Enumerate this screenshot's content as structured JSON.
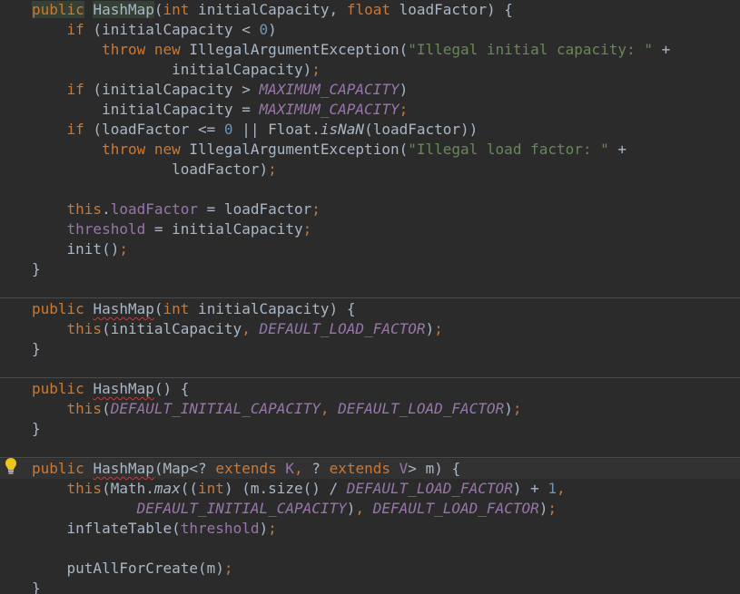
{
  "editor": {
    "lines": [
      {
        "tokens": [
          [
            "kw",
            "public"
          ],
          [
            "txt",
            " "
          ],
          [
            "ctor",
            "HashMap"
          ],
          [
            "txt",
            "("
          ],
          [
            "kw",
            "int"
          ],
          [
            "txt",
            " initialCapacity, "
          ],
          [
            "kw",
            "float"
          ],
          [
            "txt",
            " loadFactor) {"
          ]
        ]
      },
      {
        "tokens": [
          [
            "txt",
            "    "
          ],
          [
            "kw",
            "if"
          ],
          [
            "txt",
            " (initialCapacity < "
          ],
          [
            "num",
            "0"
          ],
          [
            "txt",
            ")"
          ]
        ]
      },
      {
        "tokens": [
          [
            "txt",
            "        "
          ],
          [
            "kw",
            "throw new"
          ],
          [
            "txt",
            " IllegalArgumentException("
          ],
          [
            "str",
            "\"Illegal initial capacity: \""
          ],
          [
            "txt",
            " +"
          ]
        ]
      },
      {
        "tokens": [
          [
            "txt",
            "                initialCapacity)"
          ],
          [
            "punc",
            ";"
          ]
        ]
      },
      {
        "tokens": [
          [
            "txt",
            "    "
          ],
          [
            "kw",
            "if"
          ],
          [
            "txt",
            " (initialCapacity > "
          ],
          [
            "const",
            "MAXIMUM_CAPACITY"
          ],
          [
            "txt",
            ")"
          ]
        ]
      },
      {
        "tokens": [
          [
            "txt",
            "        initialCapacity = "
          ],
          [
            "const",
            "MAXIMUM_CAPACITY"
          ],
          [
            "punc",
            ";"
          ]
        ]
      },
      {
        "tokens": [
          [
            "txt",
            "    "
          ],
          [
            "kw",
            "if"
          ],
          [
            "txt",
            " (loadFactor <= "
          ],
          [
            "num",
            "0"
          ],
          [
            "txt",
            " || Float."
          ],
          [
            "static",
            "isNaN"
          ],
          [
            "txt",
            "(loadFactor))"
          ]
        ]
      },
      {
        "tokens": [
          [
            "txt",
            "        "
          ],
          [
            "kw",
            "throw new"
          ],
          [
            "txt",
            " IllegalArgumentException("
          ],
          [
            "str",
            "\"Illegal load factor: \""
          ],
          [
            "txt",
            " +"
          ]
        ]
      },
      {
        "tokens": [
          [
            "txt",
            "                loadFactor)"
          ],
          [
            "punc",
            ";"
          ]
        ]
      },
      {
        "tokens": [
          [
            "txt",
            ""
          ]
        ]
      },
      {
        "tokens": [
          [
            "txt",
            "    "
          ],
          [
            "kw",
            "this"
          ],
          [
            "txt",
            "."
          ],
          [
            "field",
            "loadFactor"
          ],
          [
            "txt",
            " = loadFactor"
          ],
          [
            "punc",
            ";"
          ]
        ]
      },
      {
        "tokens": [
          [
            "txt",
            "    "
          ],
          [
            "field",
            "threshold"
          ],
          [
            "txt",
            " = initialCapacity"
          ],
          [
            "punc",
            ";"
          ]
        ]
      },
      {
        "tokens": [
          [
            "txt",
            "    init()"
          ],
          [
            "punc",
            ";"
          ]
        ]
      },
      {
        "tokens": [
          [
            "txt",
            "}"
          ]
        ]
      },
      {
        "tokens": [
          [
            "kw",
            "public"
          ],
          [
            "txt",
            " "
          ],
          [
            "warn",
            "HashMap"
          ],
          [
            "txt",
            "("
          ],
          [
            "kw",
            "int"
          ],
          [
            "txt",
            " initialCapacity) {"
          ]
        ]
      },
      {
        "tokens": [
          [
            "txt",
            "    "
          ],
          [
            "kw",
            "this"
          ],
          [
            "txt",
            "(initialCapacity"
          ],
          [
            "punc",
            ","
          ],
          [
            "txt",
            " "
          ],
          [
            "const",
            "DEFAULT_LOAD_FACTOR"
          ],
          [
            "txt",
            ")"
          ],
          [
            "punc",
            ";"
          ]
        ]
      },
      {
        "tokens": [
          [
            "txt",
            "}"
          ]
        ]
      },
      {
        "tokens": [
          [
            "kw",
            "public"
          ],
          [
            "txt",
            " "
          ],
          [
            "warn",
            "HashMap"
          ],
          [
            "txt",
            "() {"
          ]
        ]
      },
      {
        "tokens": [
          [
            "txt",
            "    "
          ],
          [
            "kw",
            "this"
          ],
          [
            "txt",
            "("
          ],
          [
            "const",
            "DEFAULT_INITIAL_CAPACITY"
          ],
          [
            "punc",
            ","
          ],
          [
            "txt",
            " "
          ],
          [
            "const",
            "DEFAULT_LOAD_FACTOR"
          ],
          [
            "txt",
            ")"
          ],
          [
            "punc",
            ";"
          ]
        ]
      },
      {
        "tokens": [
          [
            "txt",
            "}"
          ]
        ]
      },
      {
        "tokens": [
          [
            "kw",
            "public"
          ],
          [
            "txt",
            " "
          ],
          [
            "warn",
            "HashMap"
          ],
          [
            "txt",
            "(Map<? "
          ],
          [
            "kw",
            "extends"
          ],
          [
            "txt",
            " "
          ],
          [
            "field",
            "K"
          ],
          [
            "punc",
            ","
          ],
          [
            "txt",
            " ? "
          ],
          [
            "kw",
            "extends"
          ],
          [
            "txt",
            " "
          ],
          [
            "field",
            "V"
          ],
          [
            "txt",
            "> m) {"
          ]
        ]
      },
      {
        "tokens": [
          [
            "txt",
            "    "
          ],
          [
            "kw",
            "this"
          ],
          [
            "txt",
            "(Math."
          ],
          [
            "static",
            "max"
          ],
          [
            "txt",
            "(("
          ],
          [
            "kw",
            "int"
          ],
          [
            "txt",
            ") (m.size() / "
          ],
          [
            "const",
            "DEFAULT_LOAD_FACTOR"
          ],
          [
            "txt",
            ") + "
          ],
          [
            "num",
            "1"
          ],
          [
            "punc",
            ","
          ]
        ]
      },
      {
        "tokens": [
          [
            "txt",
            "            "
          ],
          [
            "const",
            "DEFAULT_INITIAL_CAPACITY"
          ],
          [
            "txt",
            ")"
          ],
          [
            "punc",
            ","
          ],
          [
            "txt",
            " "
          ],
          [
            "const",
            "DEFAULT_LOAD_FACTOR"
          ],
          [
            "txt",
            ")"
          ],
          [
            "punc",
            ";"
          ]
        ]
      },
      {
        "tokens": [
          [
            "txt",
            "    inflateTable("
          ],
          [
            "field",
            "threshold"
          ],
          [
            "txt",
            ")"
          ],
          [
            "punc",
            ";"
          ]
        ]
      },
      {
        "tokens": [
          [
            "txt",
            ""
          ]
        ]
      },
      {
        "tokens": [
          [
            "txt",
            "    putAllForCreate(m)"
          ],
          [
            "punc",
            ";"
          ]
        ]
      },
      {
        "tokens": [
          [
            "txt",
            "}"
          ]
        ]
      }
    ],
    "icons": {
      "gutter_intention": "lightbulb-icon"
    },
    "colors": {
      "background": "#2b2b2b",
      "keyword": "#cc7832",
      "number": "#6897bb",
      "string": "#6a8759",
      "field": "#9876aa",
      "text": "#a9b7c6"
    }
  }
}
